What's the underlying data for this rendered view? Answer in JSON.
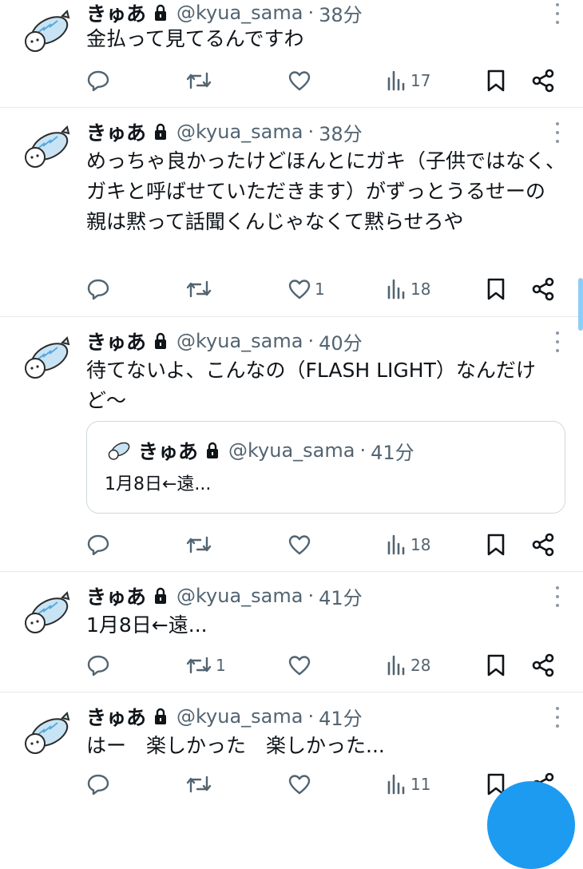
{
  "colors": {
    "text": "#0f1419",
    "secondary": "#536471",
    "accent": "#1d9bf0",
    "divider": "#e6e9ec"
  },
  "tweets": [
    {
      "name": "きゅあ",
      "handle": "@kyua_sama",
      "dot": "·",
      "time": "38分",
      "text": "金払って見てるんですわ",
      "reply_count": "",
      "retweet_count": "",
      "like_count": "",
      "views": "17"
    },
    {
      "name": "きゅあ",
      "handle": "@kyua_sama",
      "dot": "·",
      "time": "38分",
      "text": "めっちゃ良かったけどほんとにガキ（子供ではなく、ガキと呼ばせていただきます）がずっとうるせーの　親は黙って話聞くんじゃなくて黙らせろや",
      "reply_count": "",
      "retweet_count": "",
      "like_count": "1",
      "views": "18"
    },
    {
      "name": "きゅあ",
      "handle": "@kyua_sama",
      "dot": "·",
      "time": "40分",
      "text": "待てないよ、こんなの（FLASH LIGHT）なんだけど〜",
      "quote": {
        "name": "きゅあ",
        "handle": "@kyua_sama",
        "dot": "·",
        "time": "41分",
        "text": "1月8日←遠..."
      },
      "reply_count": "",
      "retweet_count": "",
      "like_count": "",
      "views": "18"
    },
    {
      "name": "きゅあ",
      "handle": "@kyua_sama",
      "dot": "·",
      "time": "41分",
      "text": "1月8日←遠...",
      "reply_count": "",
      "retweet_count": "1",
      "like_count": "",
      "views": "28"
    },
    {
      "name": "きゅあ",
      "handle": "@kyua_sama",
      "dot": "·",
      "time": "41分",
      "text": "はー　楽しかった　楽しかった...",
      "reply_count": "",
      "retweet_count": "",
      "like_count": "",
      "views": "11"
    }
  ]
}
